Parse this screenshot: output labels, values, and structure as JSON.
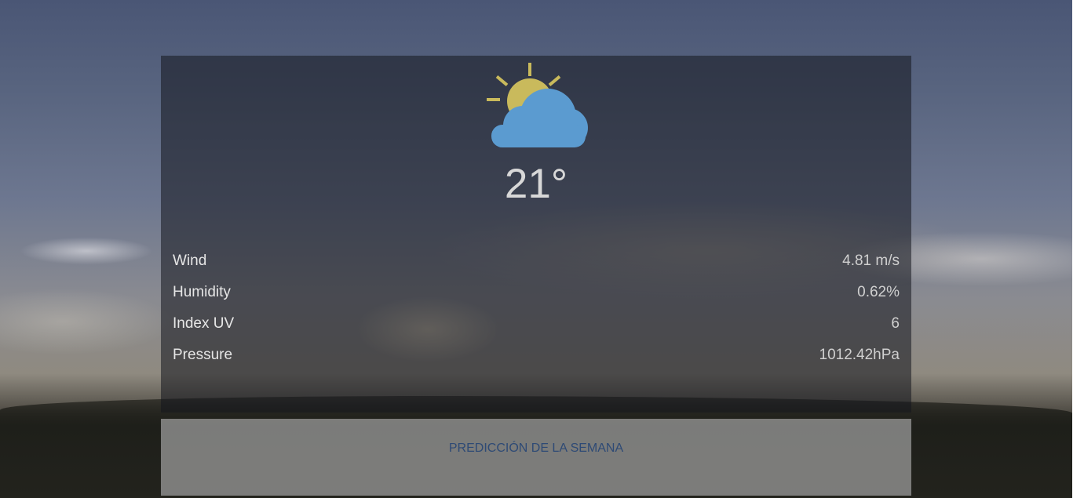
{
  "weather": {
    "icon": "partly-cloudy-icon",
    "temperature": "21°"
  },
  "stats": [
    {
      "label": "Wind",
      "value": "4.81 m/s"
    },
    {
      "label": "Humidity",
      "value": "0.62%"
    },
    {
      "label": "Index UV",
      "value": "6"
    },
    {
      "label": "Pressure",
      "value": "1012.42hPa"
    }
  ],
  "forecast": {
    "link_label": "PREDICCIÓN DE LA SEMANA"
  },
  "colors": {
    "sun": "#c9ba5c",
    "cloud": "#5b9bd0",
    "link": "#2e4a75"
  }
}
